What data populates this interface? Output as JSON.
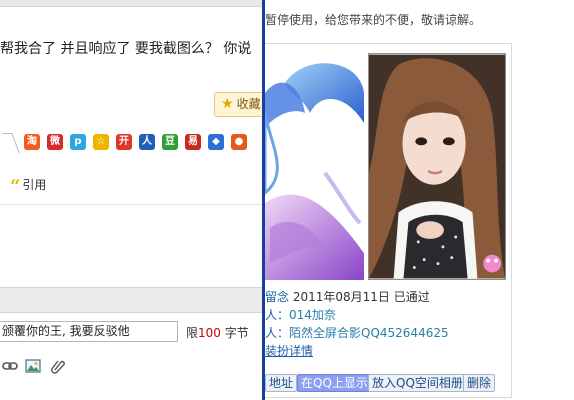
{
  "left": {
    "post_text": "帮我合了  并且响应了  要我截图么？  你说",
    "favorite_label": "收藏",
    "share_icons": [
      {
        "name": "taobao-share-icon",
        "glyph": "淘",
        "color": "#f25d1f"
      },
      {
        "name": "weibo-share-icon",
        "glyph": "微",
        "color": "#d52b2b"
      },
      {
        "name": "qzone-share-icon",
        "glyph": "p",
        "color": "#2fa8e0"
      },
      {
        "name": "star-share-icon",
        "glyph": "☆",
        "color": "#f0b400"
      },
      {
        "name": "kaixin-share-icon",
        "glyph": "开",
        "color": "#d9382a"
      },
      {
        "name": "renren-share-icon",
        "glyph": "人",
        "color": "#1e5fb8"
      },
      {
        "name": "douban-share-icon",
        "glyph": "豆",
        "color": "#2f9e3a"
      },
      {
        "name": "sohu-share-icon",
        "glyph": "易",
        "color": "#c8281e"
      },
      {
        "name": "baidu-share-icon",
        "glyph": "◆",
        "color": "#2d6fd3"
      },
      {
        "name": "fruit-share-icon",
        "glyph": "●",
        "color": "#e55a1b"
      }
    ],
    "quote_label": "引用",
    "reply_text": "颁覆你的王, 我要反驳他",
    "limit_prefix": "限",
    "limit_number": "100",
    "limit_suffix": " 字节",
    "tool_icons": [
      "link-icon",
      "image-icon",
      "attachment-icon"
    ]
  },
  "right": {
    "notice": "暂停使用，给您带来的不便，敬请谅解。",
    "meta": {
      "memo_key": "留念",
      "memo_value": " 2011年08月11日 已通过",
      "added_key": "人：",
      "added_value": "014加奈",
      "member_key": "人：",
      "member_value": "陌然全屏合影QQ452644625",
      "detail_link": "装扮详情"
    },
    "buttons": {
      "address": "地址",
      "qq_show": "在QQ上显示",
      "add_album": "放入QQ空间相册",
      "delete": "删除"
    }
  },
  "colors": {
    "window_border": "#1a3f9a",
    "link_blue": "#1b5fa8",
    "primary_button": "#8c9ff0"
  }
}
